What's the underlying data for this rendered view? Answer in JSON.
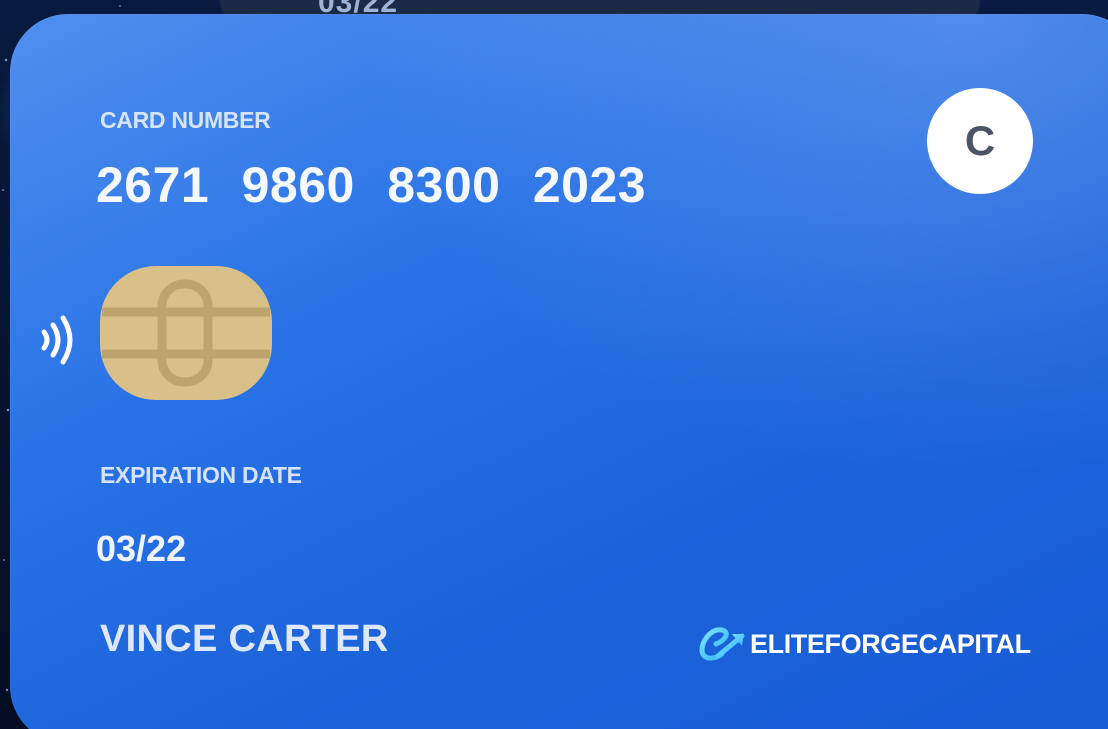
{
  "card": {
    "number_label": "CARD NUMBER",
    "number": "2671 9860 8300 2023",
    "expiration_label": "EXPIRATION DATE",
    "expiration": "03/22",
    "holder_name": "VINCE CARTER",
    "badge_letter": "C",
    "color": "#2a73e6"
  },
  "brand": {
    "name": "ELITEFORGECAPITAL",
    "mark_icon": "stylized-e-arrow-icon"
  },
  "background_card": {
    "partial_text": "03/22"
  },
  "icons": {
    "contactless": "contactless-icon",
    "chip": "emv-chip-icon"
  }
}
